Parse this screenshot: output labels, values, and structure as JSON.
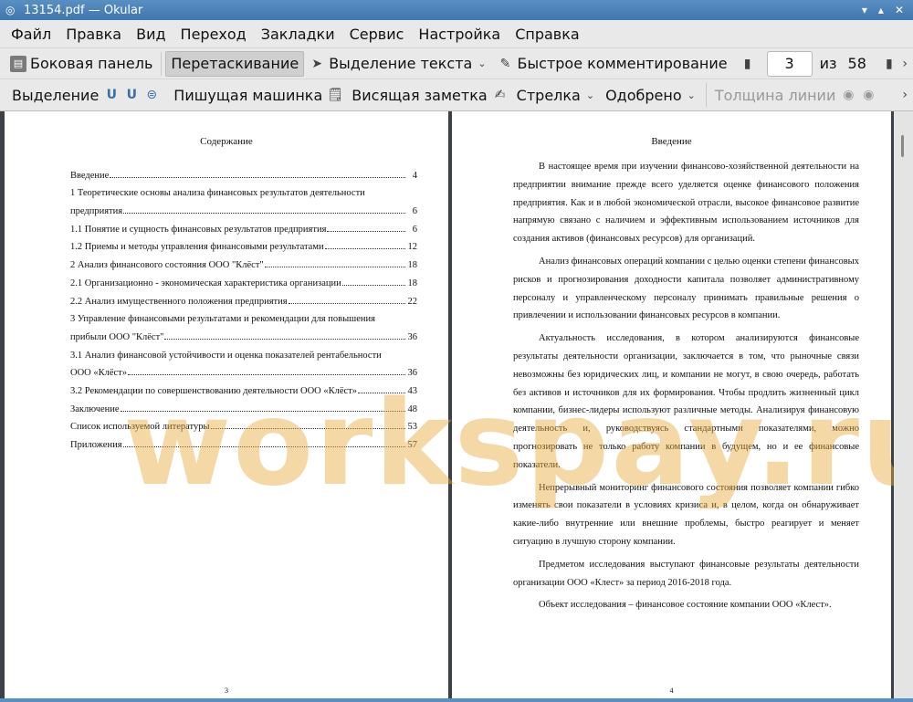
{
  "window": {
    "title": "13154.pdf  — Okular"
  },
  "menubar": [
    "Файл",
    "Правка",
    "Вид",
    "Переход",
    "Закладки",
    "Сервис",
    "Настройка",
    "Справка"
  ],
  "toolbar1": {
    "sidebar": "Боковая панель",
    "drag": "Перетаскивание",
    "text_select": "Выделение текста",
    "quick_comment": "Быстрое комментирование",
    "page_current": "3",
    "page_of": "из",
    "page_total": "58"
  },
  "toolbar2": {
    "highlight": "Выделение",
    "typewriter": "Пишущая машинка",
    "note": "Висящая заметка",
    "arrow": "Стрелка",
    "stamp": "Одобрено",
    "line_width": "Толщина линии"
  },
  "page_left": {
    "title": "Содержание",
    "page_number": "3",
    "toc": [
      {
        "text": "Введение",
        "page": "4"
      },
      {
        "text": "1 Теоретические основы анализа финансовых результатов деятельности",
        "page": ""
      },
      {
        "text": "предприятия",
        "page": "6"
      },
      {
        "text": "1.1     Понятие и сущность финансовых результатов предприятия",
        "page": "6"
      },
      {
        "text": "1.2 Приемы и методы управления финансовыми результатами",
        "page": "12"
      },
      {
        "text": "2     Анализ финансового состояния ООО \"Клёст\"",
        "page": "18"
      },
      {
        "text": "2.1       Организационно - экономическая характеристика организации",
        "page": "18"
      },
      {
        "text": "2.2 Анализ имущественного положения предприятия",
        "page": "22"
      },
      {
        "text": "3 Управление финансовыми результатами и рекомендации для повышения",
        "page": ""
      },
      {
        "text": "прибыли ООО \"Клёст\"",
        "page": "36"
      },
      {
        "text": "3.1 Анализ финансовой устойчивости и оценка показателей рентабельности",
        "page": ""
      },
      {
        "text": "ООО «Клёст»",
        "page": "36"
      },
      {
        "text": "3.2 Рекомендации по совершенствованию деятельности ООО «Клёст»",
        "page": "43"
      },
      {
        "text": "Заключение",
        "page": "48"
      },
      {
        "text": "Список используемой литературы",
        "page": "53"
      },
      {
        "text": "Приложения",
        "page": "57"
      }
    ]
  },
  "page_right": {
    "title": "Введение",
    "page_number": "4",
    "paragraphs": [
      "В настоящее время при изучении финансово-хозяйственной деятельности на предприятии внимание прежде всего уделяется оценке финансового положения предприятия. Как и в любой экономической отрасли, высокое финансовое развитие напрямую связано с наличием и эффективным использованием источников для создания активов (финансовых ресурсов) для организаций.",
      "Анализ финансовых операций компании с целью оценки степени финансовых рисков и прогнозирования доходности капитала позволяет административному персоналу и управленческому персоналу принимать правильные решения о привлечении и использовании финансовых ресурсов в компании.",
      "Актуальность исследования, в котором анализируются финансовые результаты деятельности организации, заключается в том, что рыночные связи невозможны без юридических лиц, и компании не могут, в свою очередь, работать без активов и источников для их формирования. Чтобы продлить жизненный цикл компании, бизнес-лидеры используют различные методы. Анализируя финансовую деятельность и, руководствуясь стандартными показателями, можно прогнозировать не только работу компании в будущем, но и ее финансовые показатели.",
      "Непрерывный мониторинг финансового состояния позволяет компании гибко изменять свои показатели в условиях кризиса и, в целом, когда он обнаруживает какие-либо внутренние или внешние проблемы, быстро реагирует и меняет ситуацию в лучшую сторону компании.",
      "Предметом исследования выступают финансовые результаты деятельности организации ООО «Клест» за период 2016-2018 года.",
      "Объект исследования – финансовое состояние компании ООО «Клест»."
    ]
  },
  "watermark": "workspay.ru"
}
